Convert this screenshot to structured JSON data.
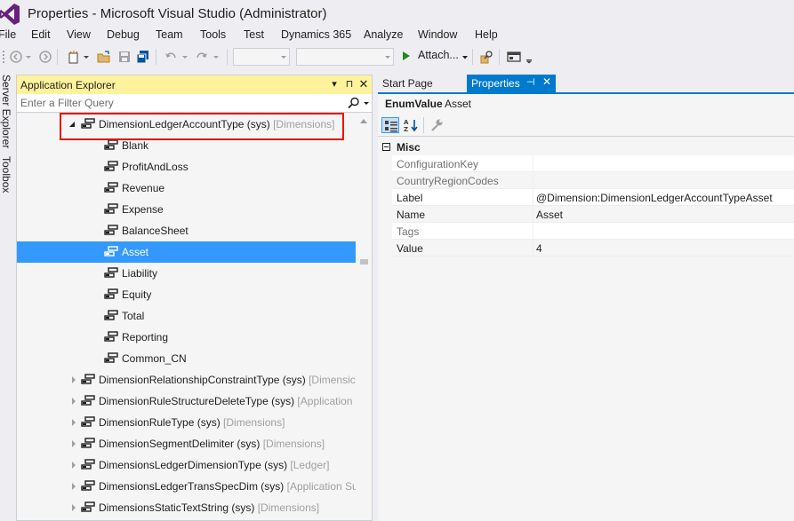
{
  "window": {
    "title": "Properties - Microsoft Visual Studio (Administrator)"
  },
  "menu": {
    "items": [
      "File",
      "Edit",
      "View",
      "Debug",
      "Team",
      "Tools",
      "Test",
      "Dynamics 365",
      "Analyze",
      "Window",
      "Help"
    ]
  },
  "toolbar": {
    "attach_label": "Attach..."
  },
  "side_tabs": {
    "server_explorer": "Server Explorer",
    "toolbox": "Toolbox"
  },
  "explorer": {
    "title": "Application Explorer",
    "filter_placeholder": "Enter a Filter Query",
    "nodes": [
      {
        "name": "DimensionLedgerAccountType",
        "suffix": " (sys)",
        "model": " [Dimensions]",
        "level": 0,
        "expanded": true
      },
      {
        "name": "Blank",
        "level": 1
      },
      {
        "name": "ProfitAndLoss",
        "level": 1
      },
      {
        "name": "Revenue",
        "level": 1
      },
      {
        "name": "Expense",
        "level": 1
      },
      {
        "name": "BalanceSheet",
        "level": 1
      },
      {
        "name": "Asset",
        "level": 1,
        "selected": true
      },
      {
        "name": "Liability",
        "level": 1
      },
      {
        "name": "Equity",
        "level": 1
      },
      {
        "name": "Total",
        "level": 1
      },
      {
        "name": "Reporting",
        "level": 1
      },
      {
        "name": "Common_CN",
        "level": 1
      },
      {
        "name": "DimensionRelationshipConstraintType",
        "suffix": " (sys)",
        "model": " [Dimensic",
        "level": 0
      },
      {
        "name": "DimensionRuleStructureDeleteType",
        "suffix": " (sys)",
        "model": " [Application",
        "level": 0
      },
      {
        "name": "DimensionRuleType",
        "suffix": " (sys)",
        "model": " [Dimensions]",
        "level": 0
      },
      {
        "name": "DimensionSegmentDelimiter",
        "suffix": " (sys)",
        "model": " [Dimensions]",
        "level": 0
      },
      {
        "name": "DimensionsLedgerDimensionType",
        "suffix": " (sys)",
        "model": " [Ledger]",
        "level": 0
      },
      {
        "name": "DimensionsLedgerTransSpecDim",
        "suffix": " (sys)",
        "model": " [Application Su",
        "level": 0
      },
      {
        "name": "DimensionsStaticTextString",
        "suffix": " (sys)",
        "model": " [Dimensions]",
        "level": 0
      }
    ]
  },
  "doc_tabs": {
    "start_page": "Start Page",
    "properties": "Properties"
  },
  "properties": {
    "object_type": "EnumValue",
    "object_name": "Asset",
    "category": "Misc",
    "rows": [
      {
        "name": "ConfigurationKey",
        "value": ""
      },
      {
        "name": "CountryRegionCodes",
        "value": ""
      },
      {
        "name": "Label",
        "value": "@Dimension:DimensionLedgerAccountTypeAsset"
      },
      {
        "name": "Name",
        "value": "Asset"
      },
      {
        "name": "Tags",
        "value": ""
      },
      {
        "name": "Value",
        "value": "4"
      }
    ]
  },
  "colors": {
    "accent": "#007acc",
    "selection": "#3399ff",
    "panel_header": "#fff29d",
    "highlight_box": "#e51400"
  }
}
